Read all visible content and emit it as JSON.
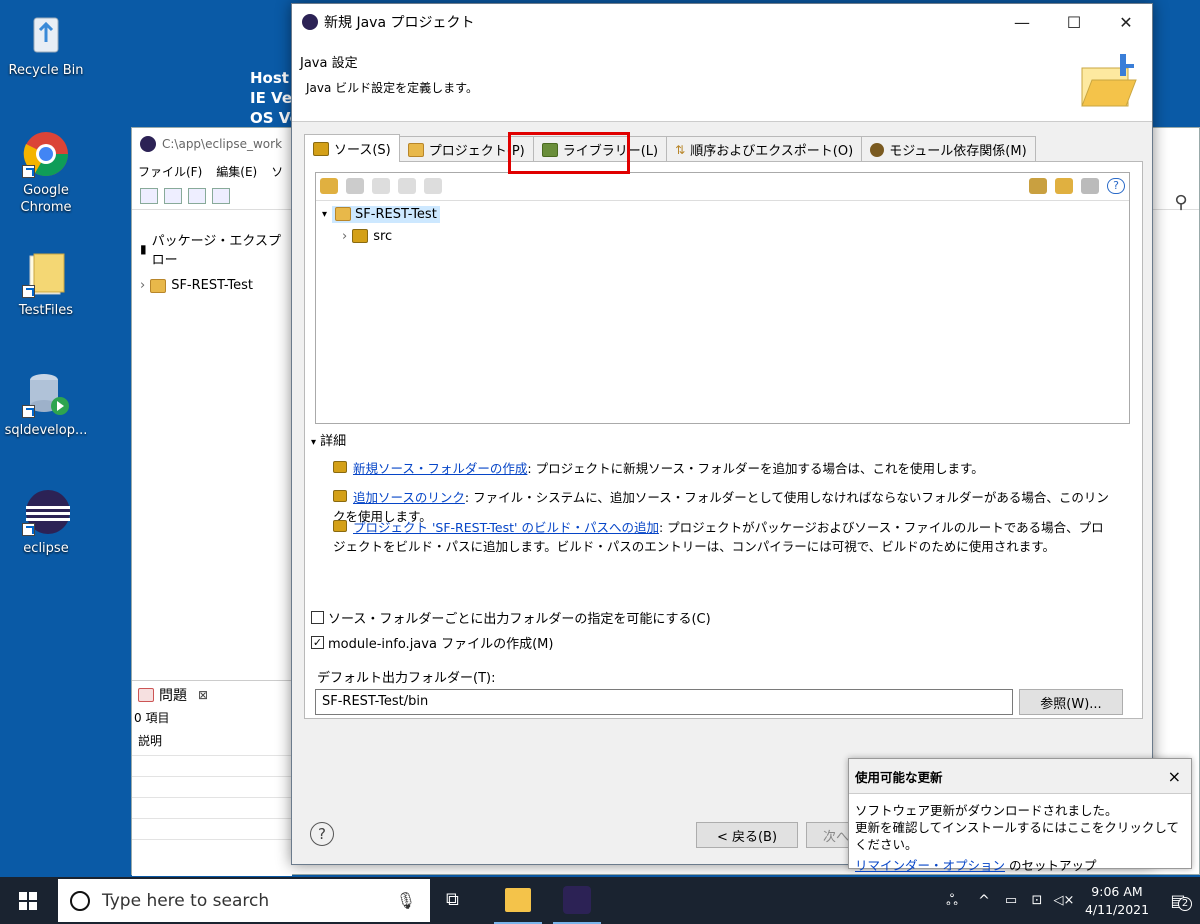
{
  "desktop": {
    "icons": [
      {
        "label": "Recycle Bin",
        "icon": "recycle-bin-icon"
      },
      {
        "label": "Google Chrome",
        "icon": "chrome-icon"
      },
      {
        "label": "TestFiles",
        "icon": "folder-icon"
      },
      {
        "label": "sqldevelop...",
        "icon": "database-icon"
      },
      {
        "label": "eclipse",
        "icon": "eclipse-icon"
      }
    ],
    "host_info": [
      "Host I",
      "IE Ver",
      "OS Ve"
    ]
  },
  "eclipse_window": {
    "title": "C:\\app\\eclipse_work",
    "menu": [
      "ファイル(F)",
      "編集(E)",
      "ソ"
    ],
    "package_explorer_title": "パッケージ・エクスプロー",
    "project": "SF-REST-Test",
    "problems_title": "問題",
    "problems_count": "0 項目",
    "problems_col": "説明"
  },
  "dialog": {
    "title": "新規 Java プロジェクト",
    "banner_title": "Java 設定",
    "banner_desc": "Java ビルド設定を定義します。",
    "tabs": [
      {
        "label": "ソース(S)",
        "active": true
      },
      {
        "label": "プロジェクト(P)",
        "active": false
      },
      {
        "label": "ライブラリー(L)",
        "active": false
      },
      {
        "label": "順序およびエクスポート(O)",
        "active": false
      },
      {
        "label": "モジュール依存関係(M)",
        "active": false
      }
    ],
    "tree": {
      "root": "SF-REST-Test",
      "child": "src"
    },
    "details_header": "詳細",
    "details": [
      {
        "link": "新規ソース・フォルダーの作成",
        "text": ": プロジェクトに新規ソース・フォルダーを追加する場合は、これを使用します。"
      },
      {
        "link": "追加ソースのリンク",
        "text": ": ファイル・システムに、追加ソース・フォルダーとして使用しなければならないフォルダーがある場合、このリンクを使用します。"
      },
      {
        "link": "プロジェクト 'SF-REST-Test' のビルド・パスへの追加",
        "text": ": プロジェクトがパッケージおよびソース・ファイルのルートである場合、プロジェクトをビルド・パスに追加します。ビルド・パスのエントリーは、コンパイラーには可視で、ビルドのために使用されます。"
      }
    ],
    "checkbox1": {
      "label": "ソース・フォルダーごとに出力フォルダーの指定を可能にする(C)",
      "checked": ""
    },
    "checkbox2": {
      "label": "module-info.java ファイルの作成(M)",
      "checked": "✓"
    },
    "output_label": "デフォルト出力フォルダー(T):",
    "output_value": "SF-REST-Test/bin",
    "browse_button": "参照(W)...",
    "back_button": "< 戻る(B)",
    "next_button": "次へ",
    "help": "?"
  },
  "notification": {
    "title": "使用可能な更新",
    "line1": "ソフトウェア更新がダウンロードされました。",
    "line2": "更新を確認してインストールするにはここをクリックしてください。",
    "link": "リマインダー・オプション",
    "link_suffix": " のセットアップ",
    "close": "×"
  },
  "taskbar": {
    "search_placeholder": "Type here to search",
    "time": "9:06 AM",
    "date": "4/11/2021",
    "notif_count": "2"
  }
}
